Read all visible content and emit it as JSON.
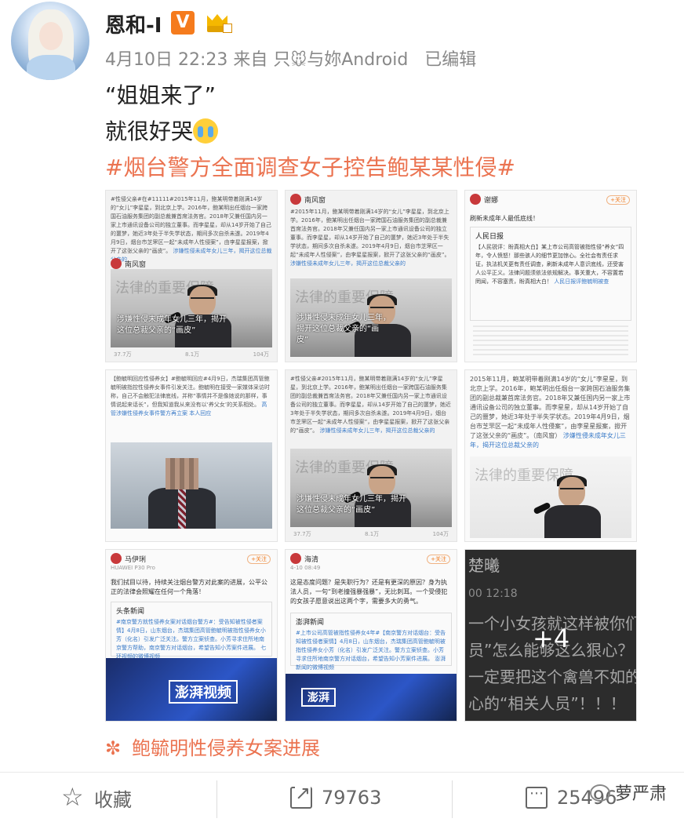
{
  "post": {
    "username": "恩和-I",
    "vip_badge": "V",
    "time": "4月10日 22:23",
    "from_prefix": "来自 只",
    "device": "与妳Android",
    "edited": "已编辑",
    "line1": "“姐姐来了”",
    "line2": "就很好哭",
    "hashtag": "#烟台警方全面调查女子控告鲍某某性侵#",
    "topic": "鲍毓明性侵养女案进展"
  },
  "images": {
    "cell1": {
      "text": "#性侵父亲#在#11111#2015年11月，鲍某明带着刚满14岁的“女儿”李星星，到北京上学。2016年，鲍某明出任烟台一家跨国石油服务集团的副总裁兼首席法务官。2018年又兼任国内另一家上市通讯设备公司的独立董事。而李星星，却从14岁开始了自己的噩梦，她近3年处于半失学状态，期间多次自杀未遂。2019年4月9日，烟台市芝罘区一起“未成年人性侵案”，由李星星报案，掀开了这张父亲的“画皮”。",
      "link": "涉嫌性侵未成年女儿三年，揭开这位总裁父亲的",
      "channel": "南风窗",
      "caption": "涉嫌性侵未成年女儿三年，揭开这位总裁父亲的“画皮”",
      "bg": "法律的重要保障",
      "stat1": "37.7万",
      "stat2": "8.1万",
      "stat3": "104万"
    },
    "cell2": {
      "author": "南风窗",
      "text": "#2015年11月，鲍某明带着刚满14岁的“女儿”李星星，到北京上学。2016年，鲍某明出任烟台一家跨国石油服务集团的副总裁兼首席法务官。2018年又兼任国内另一家上市通讯设备公司的独立董事。而李星星，却从14岁开始了自己的噩梦，她近3年处于半失学状态，期间多次自杀未遂。2019年4月9日，烟台市芝罘区一起“未成年人性侵案”，由李星星报案，掀开了这张父亲的“画皮”。",
      "link": "涉嫌性侵未成年女儿三年，揭开这位总裁父亲的",
      "caption": "涉嫌性侵未成年女儿三年，揭开这位总裁父亲的“画皮”",
      "bg": "法律的重要保障",
      "follow": "+关注"
    },
    "cell3": {
      "author": "谢娜",
      "post": "刷新未成年人最低底线！",
      "source": "人民日报",
      "text": "【人民锐评：盼真相大白】某上市公司高管被指性侵“养女”四年，令人愤怒！那些骇人的细节更加惊心。全社会有责任求证，执法机关更有责任调查，刷新未成年人意识底线，还受害人公平正义。法律问题须依法依规解决。事关重大，不容置若罔闻，不容塞责，盼真相大白！",
      "link": "人民日报评鲍毓明被查",
      "follow": "+关注"
    },
    "cell4": {
      "text": "【鲍毓明回应性侵养女】#鲍毓明回应#4月9日，杰瑞集团高管鲍毓明被指控性侵养女事件引发关注。鲍毓明在接受一家媒体采访时称，自己不会触犯法律底线，并称“事情并不是像她说的那样，事情说起来话长”，但我知道我从来没有以‘养父女’的关系相处。",
      "link": "高管涉嫌性侵养女事件警方再立案 本人回应"
    },
    "cell5": {
      "text": "#性侵父亲#2015年11月，鲍某明带着刚满14岁的“女儿”李星星，到北京上学。2016年，鲍某明出任烟台一家跨国石油服务集团的副总裁兼首席法务官。2018年又兼任国内另一家上市通讯设备公司的独立董事。而李星星，却从14岁开始了自己的噩梦，她近3年处于半失学状态，期间多次自杀未遂。2019年4月9日，烟台市芝罘区一起“未成年人性侵案”，由李星星报案，掀开了这张父亲的“画皮”。",
      "link": "涉嫌性侵未成年女儿三年，揭开这位总裁父亲的",
      "caption": "涉嫌性侵未成年女儿三年，揭开这位总裁父亲的“画皮”",
      "bg": "法律的重要保障",
      "stat1": "37.7万",
      "stat2": "8.1万",
      "stat3": "104万"
    },
    "cell6": {
      "text": "2015年11月，鲍某明带着刚满14岁的“女儿”李星星，到北京上学。2016年，鲍某明出任烟台一家跨国石油服务集团的副总裁兼首席法务官。2018年又兼任国内另一家上市通讯设备公司的独立董事。而李星星，却从14岁开始了自己的噩梦，她近3年处于半失学状态。2019年4月9日，烟台市芝罘区一起“未成年人性侵案”，由李星星报案，掀开了这张父亲的“画皮”。（南风窗）",
      "link": "涉嫌性侵未成年女儿三年，揭开这位总裁父亲的",
      "bg": "法律的重要保障"
    },
    "cell7": {
      "author": "马伊琍",
      "device": "HUAWEI P30 Pro",
      "post": "我们拭目以待，持续关注烟台警方对此案的进展，公平公正的法律会照耀在任何一个角落！",
      "source": "头条新闻",
      "card": "#南京警方就性侵养女案对话烟台警方#：受告知被性侵者案情】4月8日，山东烟台，杰瑞集团高管鲍毓明被指性侵养女小芳（化名）引发广泛关注。警方立案侦查。小芳寻求住所地南京警方帮助，南京警方对话烟台，希望告知小芳案件进展。",
      "link": "七环视频的微博视频",
      "video": "澎湃视频",
      "follow": "+关注"
    },
    "cell8": {
      "author": "海清",
      "time": "4-10 08:49",
      "post": "这是态度问题？是失职行为？还是有更深的原因？身为执法人员，一句“到老撞强暴强暴”，无比刺耳。一个受侵犯的女孩子愿意说出这两个字，需要多大的勇气。",
      "source": "澎湃新闻",
      "card": "#上市公司高管被指性侵养女4年#【南京警方对话烟台：受告知被性侵者案情】4月8日，山东烟台，杰瑞集团高管鲍毓明被指性侵养女小芳（化名）引发广泛关注。警方立案侦查。小芳寻求住所地南京警方对话烟台，希望告知小芳案件进展。",
      "link": "澎湃新闻的微博视频",
      "video": "澎湃",
      "follow": "+关注"
    },
    "cell9": {
      "author": "楚曦",
      "time": "00 12:18",
      "lines": [
        "一个小女孩就这样被你们毁",
        "员”怎么能够这么狠心？！",
        "一定要把这个禽兽不如的X",
        "心的“相关人员”！！！"
      ],
      "more": "+4"
    }
  },
  "footer": {
    "favorite": "收藏",
    "share_count": "79763",
    "comment_count": "25496",
    "watermark": "萝严肃"
  },
  "icons": {
    "favorite": "star-icon",
    "share": "share-icon",
    "comment": "comment-icon",
    "topic": "flower-icon"
  },
  "colors": {
    "accent": "#eb7350",
    "vip": "#f57b1d"
  }
}
